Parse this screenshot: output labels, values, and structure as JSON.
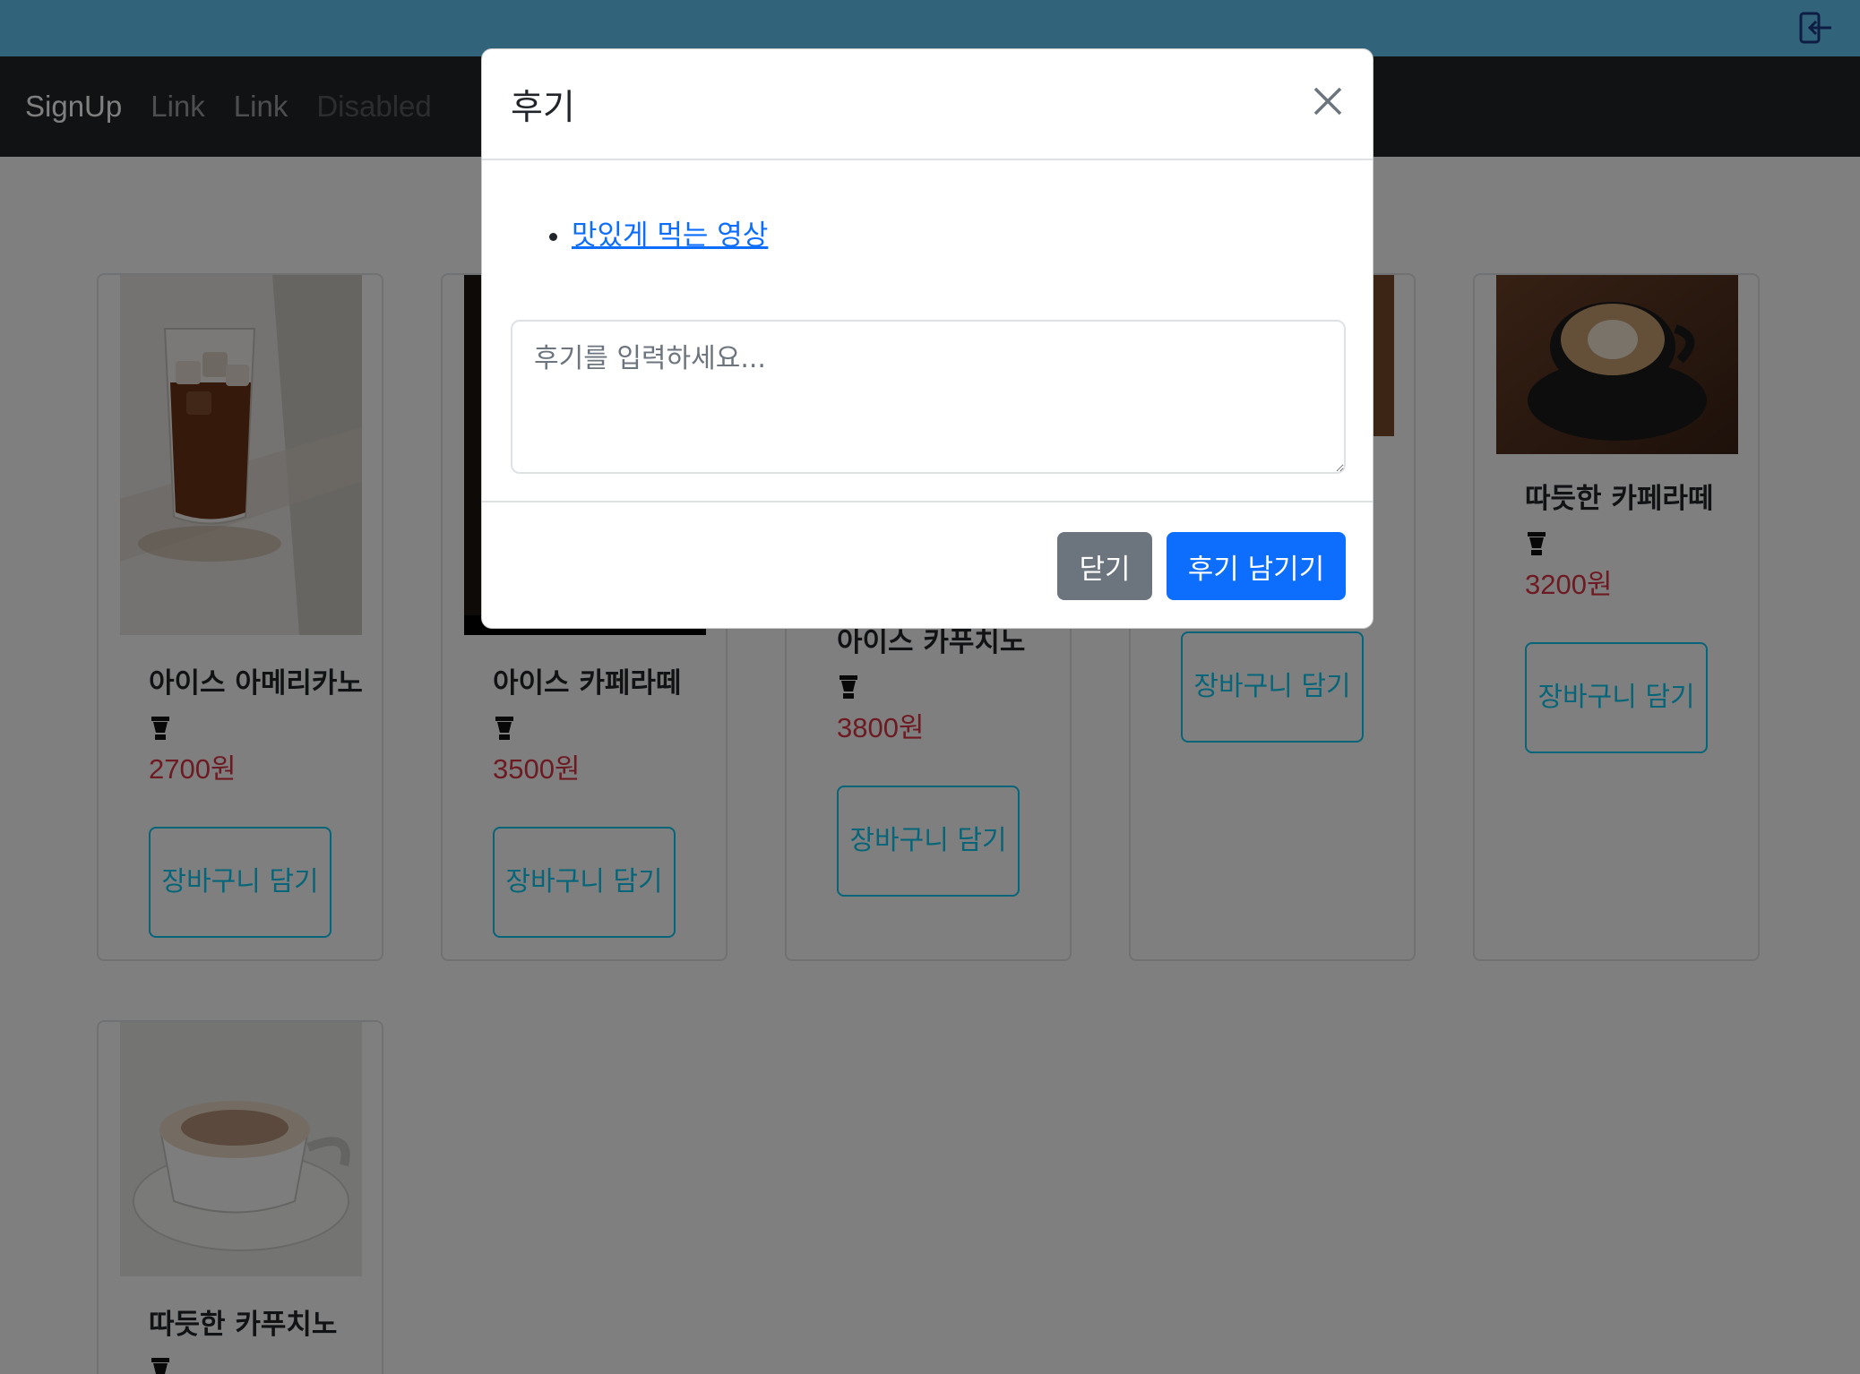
{
  "nav": {
    "brand": "SignUp",
    "links": [
      "Link",
      "Link"
    ],
    "disabled": "Disabled"
  },
  "products": [
    {
      "name": "아이스 아메리카노",
      "price": "2700원",
      "cart_label": "장바구니 담기",
      "image": "iced-americano"
    },
    {
      "name": "아이스 카페라떼",
      "price": "3500원",
      "cart_label": "장바구니 담기",
      "image": "iced-latte"
    },
    {
      "name": "아이스 카푸치노",
      "price": "3800원",
      "cart_label": "장바구니 담기",
      "image": "iced-cappuccino"
    },
    {
      "name": "",
      "price": "",
      "cart_label": "장바구니 담기",
      "image": "hidden"
    },
    {
      "name": "따듯한 카페라떼",
      "price": "3200원",
      "cart_label": "장바구니 담기",
      "image": "hot-latte"
    },
    {
      "name": "따듯한 카푸치노",
      "price": "",
      "cart_label": "",
      "image": "hot-cappuccino"
    }
  ],
  "modal": {
    "title": "후기",
    "video_link": "맛있게 먹는 영상",
    "review_placeholder": "후기를 입력하세요...",
    "close_label": "닫기",
    "submit_label": "후기 남기기"
  },
  "colors": {
    "topbar": "#62c8f4",
    "navbar": "#212529",
    "price": "#dc3545",
    "cart_button": "#0dcaf0",
    "primary": "#0d6efd",
    "secondary": "#6c757d"
  }
}
